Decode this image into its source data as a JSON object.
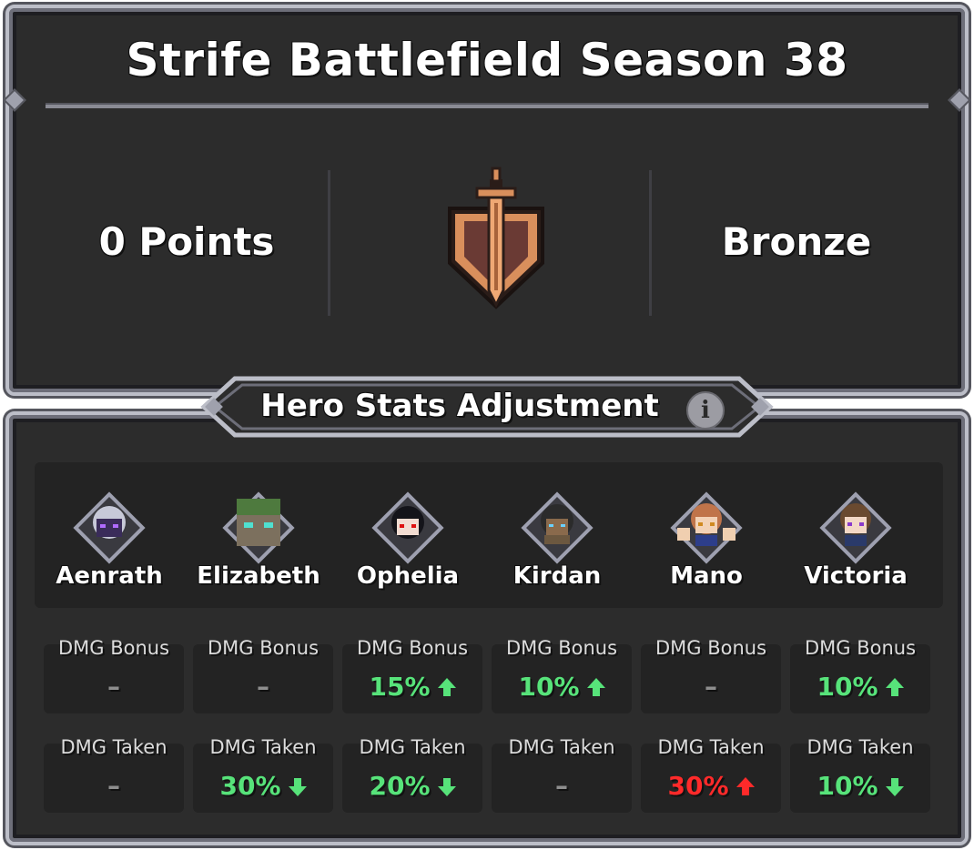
{
  "season": {
    "title": "Strife Battlefield Season 38"
  },
  "rank": {
    "points": "0 Points",
    "tier": "Bronze",
    "emblem_icon": "bronze-sword-shield-emblem"
  },
  "adjustment": {
    "title": "Hero Stats Adjustment",
    "info_icon": "i"
  },
  "colors": {
    "increase_good": "#57e37a",
    "increase_bad": "#ff2a2a",
    "neutral": "#8e8e8e"
  },
  "heroes": [
    {
      "name": "Aenrath",
      "dmg_bonus": {
        "label": "DMG Bonus",
        "value": "–",
        "arrow": ""
      },
      "dmg_taken": {
        "label": "DMG Taken",
        "value": "–",
        "arrow": ""
      }
    },
    {
      "name": "Elizabeth",
      "dmg_bonus": {
        "label": "DMG Bonus",
        "value": "–",
        "arrow": ""
      },
      "dmg_taken": {
        "label": "DMG Taken",
        "value": "30%",
        "arrow": "down"
      }
    },
    {
      "name": "Ophelia",
      "dmg_bonus": {
        "label": "DMG Bonus",
        "value": "15%",
        "arrow": "up"
      },
      "dmg_taken": {
        "label": "DMG Taken",
        "value": "20%",
        "arrow": "down"
      }
    },
    {
      "name": "Kirdan",
      "dmg_bonus": {
        "label": "DMG Bonus",
        "value": "10%",
        "arrow": "up"
      },
      "dmg_taken": {
        "label": "DMG Taken",
        "value": "–",
        "arrow": ""
      }
    },
    {
      "name": "Mano",
      "dmg_bonus": {
        "label": "DMG Bonus",
        "value": "–",
        "arrow": ""
      },
      "dmg_taken": {
        "label": "DMG Taken",
        "value": "30%",
        "arrow": "up"
      }
    },
    {
      "name": "Victoria",
      "dmg_bonus": {
        "label": "DMG Bonus",
        "value": "10%",
        "arrow": "up"
      },
      "dmg_taken": {
        "label": "DMG Taken",
        "value": "10%",
        "arrow": "down"
      }
    }
  ]
}
